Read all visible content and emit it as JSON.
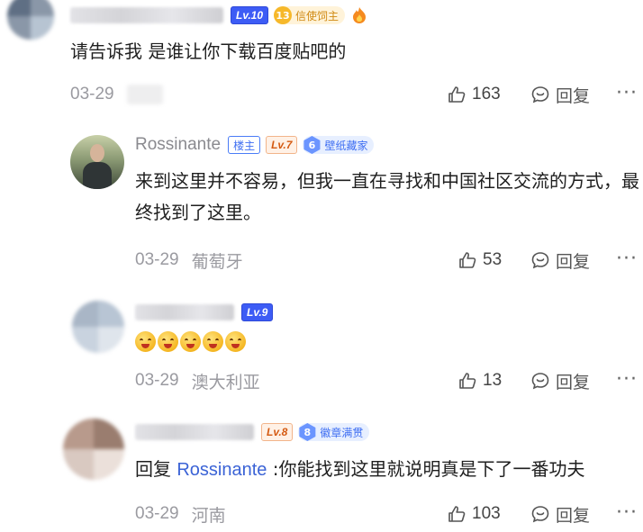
{
  "comments": [
    {
      "level": "Lv.10",
      "badge": {
        "num": "13",
        "text": "信使饲主"
      },
      "text": "请告诉我 是谁让你下载百度贴吧的",
      "date": "03-29",
      "likes": "163",
      "reply_label": "回复",
      "more": "···"
    },
    {
      "username": "Rossinante",
      "owner_label": "楼主",
      "level": "Lv.7",
      "badge": {
        "num": "6",
        "text": "壁纸藏家"
      },
      "text": "来到这里并不容易，但我一直在寻找和中国社区交流的方式，最终找到了这里。",
      "date": "03-29",
      "location": "葡萄牙",
      "likes": "53",
      "reply_label": "回复",
      "more": "···"
    },
    {
      "level": "Lv.9",
      "emoji_count": 5,
      "date": "03-29",
      "location": "澳大利亚",
      "likes": "13",
      "reply_label": "回复",
      "more": "···"
    },
    {
      "level": "Lv.8",
      "badge": {
        "num": "8",
        "text": "徽章满贯"
      },
      "reply_prefix": "回复 ",
      "reply_to": "Rossinante",
      "text": " :你能找到这里就说明真是下了一番功夫",
      "date": "03-29",
      "location": "河南",
      "likes": "103",
      "reply_label": "回复",
      "more": "···"
    }
  ],
  "colors": {
    "link_blue": "#3b63d6",
    "meta_gray": "#9a9aa0",
    "level_blue": "#3d5cf5",
    "level_orange": "#d45a12"
  }
}
